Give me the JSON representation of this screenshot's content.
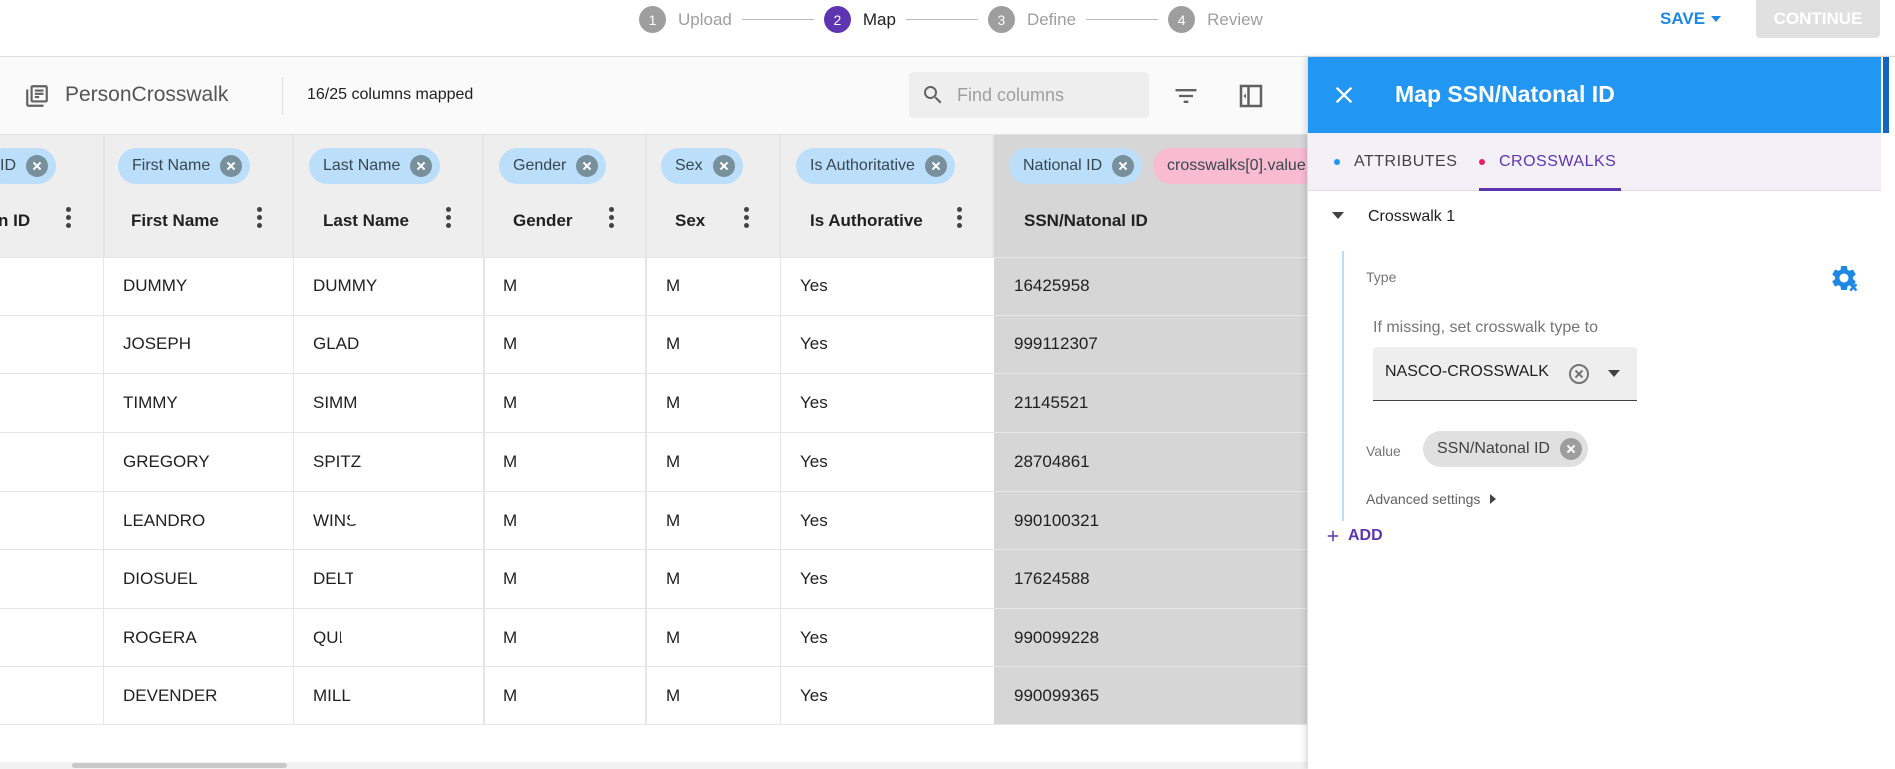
{
  "stepper": {
    "steps": [
      {
        "num": "1",
        "label": "Upload"
      },
      {
        "num": "2",
        "label": "Map"
      },
      {
        "num": "3",
        "label": "Define"
      },
      {
        "num": "4",
        "label": "Review"
      }
    ],
    "active_step": 2
  },
  "actions": {
    "save_label": "SAVE",
    "continue_label": "CONTINUE"
  },
  "toolbar": {
    "dataset_title": "PersonCrosswalk",
    "mapped_count": "16/25 columns mapped",
    "search_placeholder": "Find columns",
    "icons": [
      "table-icon",
      "search-icon",
      "filter-icon",
      "side-panel-icon"
    ]
  },
  "grid": {
    "columns": [
      {
        "chip": "ID",
        "title": "n ID"
      },
      {
        "chip": "First Name",
        "title": "First Name"
      },
      {
        "chip": "Last Name",
        "title": "Last Name"
      },
      {
        "chip": "Gender",
        "title": "Gender"
      },
      {
        "chip": "Sex",
        "title": "Sex"
      },
      {
        "chip": "Is Authoritative",
        "title": "Is Authorative"
      },
      {
        "chip": "National ID",
        "chip2": "crosswalks[0].value",
        "title": "SSN/Natonal ID"
      }
    ],
    "rows": [
      [
        "",
        "DUMMY",
        "DUMMY",
        "M",
        "M",
        "Yes",
        "16425958"
      ],
      [
        "",
        "JOSEPH",
        "GLAD",
        "M",
        "M",
        "Yes",
        "999112307"
      ],
      [
        "",
        "TIMMY",
        "SIMM",
        "M",
        "M",
        "Yes",
        "21145521"
      ],
      [
        "",
        "GREGORY",
        "SPITZ",
        "M",
        "M",
        "Yes",
        "28704861"
      ],
      [
        "",
        "LEANDRO",
        "WINS",
        "M",
        "M",
        "Yes",
        "990100321"
      ],
      [
        "",
        "DIOSUEL",
        "DELT",
        "M",
        "M",
        "Yes",
        "17624588"
      ],
      [
        "",
        "ROGERA",
        "QUI",
        "M",
        "M",
        "Yes",
        "990099228"
      ],
      [
        "",
        "DEVENDER",
        "MILL",
        "M",
        "M",
        "Yes",
        "990099365"
      ]
    ]
  },
  "panel": {
    "title": "Map SSN/Natonal ID",
    "tabs": {
      "attributes": "ATTRIBUTES",
      "crosswalks": "CROSSWALKS"
    },
    "active_tab": "CROSSWALKS",
    "crosswalk": {
      "title": "Crosswalk 1",
      "type_label": "Type",
      "missing_label": "If missing, set crosswalk type to",
      "type_value": "NASCO-CROSSWALK",
      "value_label": "Value",
      "value_chip": "SSN/Natonal ID",
      "advanced_label": "Advanced settings"
    },
    "add_label": "ADD"
  },
  "colors": {
    "accent_purple": "#5e35b1",
    "header_blue": "#2196f3",
    "save_blue": "#1e88e5",
    "chip_blue": "#bbdefb",
    "chip_pink": "#f8bbd0"
  }
}
